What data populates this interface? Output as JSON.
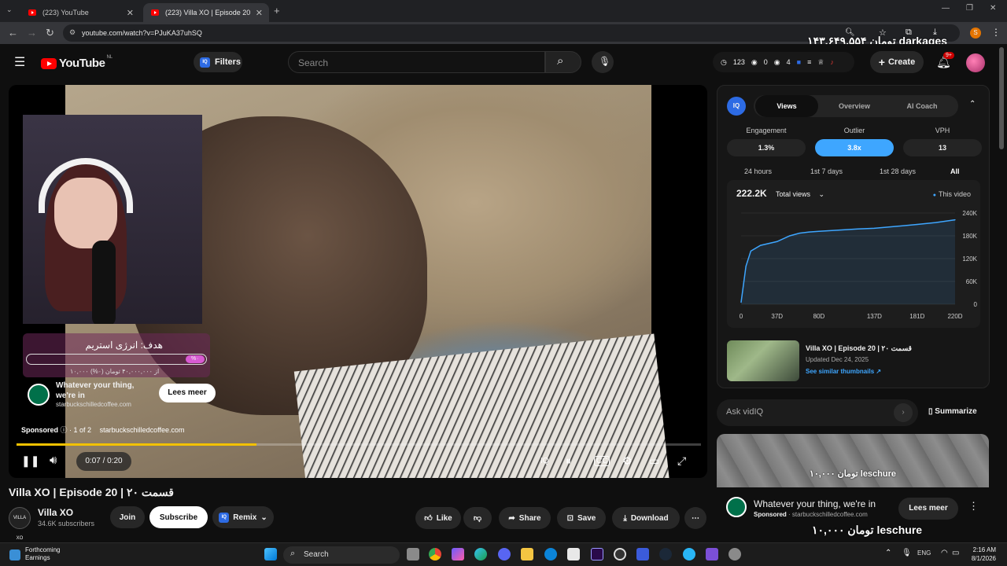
{
  "browser": {
    "tabs": [
      {
        "title": "(223) YouTube"
      },
      {
        "title": "(223) Villa XO | Episode 20"
      }
    ],
    "url": "youtube.com/watch?v=PJuKA37uhSQ",
    "new_tab_symbol": "+",
    "profile_initial": "S"
  },
  "overlays": {
    "top_donation": "۱۴۳,۶۴۹,۵۵۴ تومان darkages",
    "bottom_donation": "۱۰,۰۰۰ تومان leschure"
  },
  "header": {
    "logo_text": "YouTube",
    "region": "NL",
    "filters_label": "Filters",
    "iq_badge": "IQ",
    "search_placeholder": "Search",
    "stats": {
      "watch": "123",
      "views": "0",
      "other": "4"
    },
    "create_label": "Create",
    "notif_badge": "9+"
  },
  "player": {
    "goal_title": "هدف: انرژی استریم",
    "goal_percent": "%۰",
    "goal_sub": "۱۰,۰۰۰ از ۴۰,۰۰۰,۰۰۰ تومان (۰%)",
    "ad_text": "Whatever your thing, we're in",
    "ad_domain": "starbuckschilledcoffee.com",
    "lees_meer": "Lees meer",
    "sponsored": "Sponsored",
    "ad_count": "1 of 2",
    "ad_domain2": "starbuckschilledcoffee.com",
    "time": "0:07 / 0:20",
    "progress_fraction": 0.35
  },
  "video": {
    "title": "Villa XO | Episode 20 | قسمت ۲۰",
    "channel": "Villa XO",
    "channel_avatar": "VILLA XO",
    "subscribers": "34.6K subscribers",
    "join": "Join",
    "subscribe": "Subscribe",
    "remix": "Remix",
    "like": "Like",
    "share": "Share",
    "save": "Save",
    "download": "Download"
  },
  "vidiq": {
    "logo": "IQ",
    "tabs": [
      "Views",
      "Overview",
      "AI Coach"
    ],
    "metrics": [
      {
        "label": "Engagement",
        "value": "1.3%"
      },
      {
        "label": "Outlier",
        "value": "3.8x"
      },
      {
        "label": "VPH",
        "value": "13"
      }
    ],
    "ranges": [
      "24 hours",
      "1st 7 days",
      "1st 28 days",
      "All"
    ],
    "total_views": "222.2K",
    "total_views_label": "Total views",
    "legend": "This video",
    "related_title": "Villa XO | Episode 20 | قسمت ۲۰",
    "related_date": "Updated Dec 24, 2025",
    "similar_link": "See similar thumbnails ↗",
    "ask_placeholder": "Ask vidIQ",
    "summarize": "Summarize"
  },
  "chart_data": {
    "type": "area",
    "x": [
      0,
      5,
      10,
      20,
      37,
      50,
      60,
      70,
      80,
      100,
      120,
      137,
      160,
      181,
      200,
      220
    ],
    "values": [
      5000,
      100000,
      140000,
      155000,
      165000,
      180000,
      187000,
      190000,
      192000,
      195000,
      198000,
      200000,
      205000,
      210000,
      215000,
      222200
    ],
    "x_tick_labels": [
      "0",
      "37D",
      "80D",
      "137D",
      "181D",
      "220D"
    ],
    "y_tick_labels": [
      "240K",
      "180K",
      "120K",
      "60K",
      "0"
    ],
    "ylim": [
      0,
      240000
    ],
    "xlim": [
      0,
      220
    ],
    "series_name": "This video",
    "legend_position": "top-right",
    "color": "#3ea6ff"
  },
  "sidebar_ad": {
    "banner_text": "۱۰,۰۰۰ تومان leschure",
    "title": "Whatever your thing, we're in",
    "sponsored": "Sponsored",
    "domain": "starbuckschilledcoffee.com",
    "lees_meer": "Lees meer"
  },
  "taskbar": {
    "weather_title": "Forthcoming",
    "weather_sub": "Earnings",
    "search": "Search",
    "lang": "ENG",
    "time": "2:16 AM",
    "date": "8/1/2026"
  }
}
